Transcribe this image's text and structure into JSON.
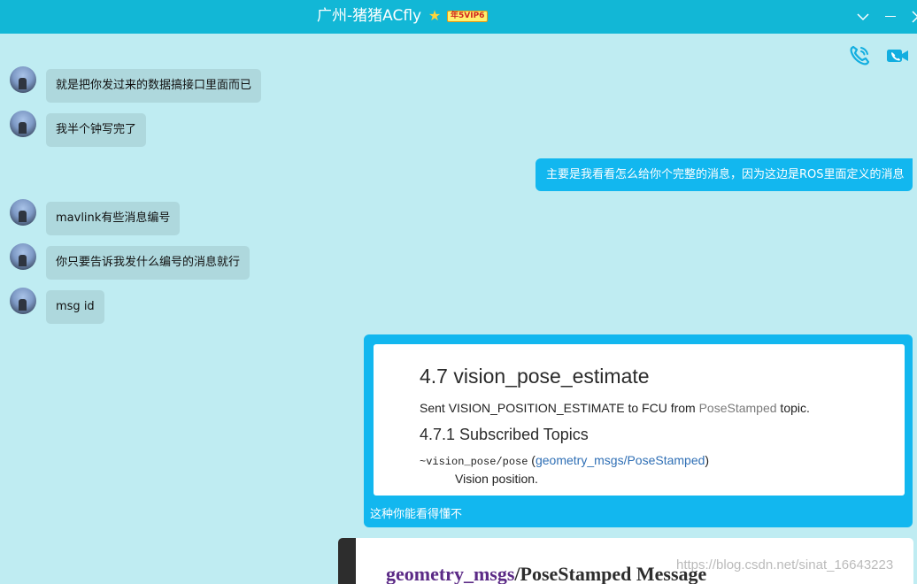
{
  "window": {
    "title": "广州-猪猪ACfly",
    "vip_badge": "年5VIP6",
    "controls": [
      "chevron-down-icon",
      "minimize-icon",
      "close-icon"
    ]
  },
  "header_actions": [
    "voice-call-icon",
    "video-call-icon"
  ],
  "messages": [
    {
      "side": "in",
      "text": "就是把你发过来的数据搞接口里面而已"
    },
    {
      "side": "in",
      "text": "我半个钟写完了"
    },
    {
      "side": "out",
      "text": "主要是我看看怎么给你个完整的消息，因为这边是ROS里面定义的消息"
    },
    {
      "side": "in",
      "text": "mavlink有些消息编号"
    },
    {
      "side": "in",
      "text": "你只要告诉我发什么编号的消息就行"
    },
    {
      "side": "in",
      "text": "msg id"
    }
  ],
  "image_message": {
    "heading": "4.7 vision_pose_estimate",
    "paragraph": {
      "before": "Sent VISION_POSITION_ESTIMATE to FCU from ",
      "muted": "PoseStamped",
      "after": " topic."
    },
    "subheading": "4.7.1 Subscribed Topics",
    "topic": "~vision_pose/pose",
    "topic_link": "geometry_msgs/PoseStamped",
    "topic_description": "Vision position.",
    "caption": "这种你能看得懂不"
  },
  "image_message_2": {
    "package": "geometry_msgs",
    "rest": "/PoseStamped Message"
  },
  "watermark": "https://blog.csdn.net/sinat_16643223",
  "colors": {
    "title_bar": "#12b7d6",
    "chat_background": "#bfecf2",
    "incoming_bubble": "#aed8dd",
    "outgoing_bubble": "#12b7ef"
  }
}
